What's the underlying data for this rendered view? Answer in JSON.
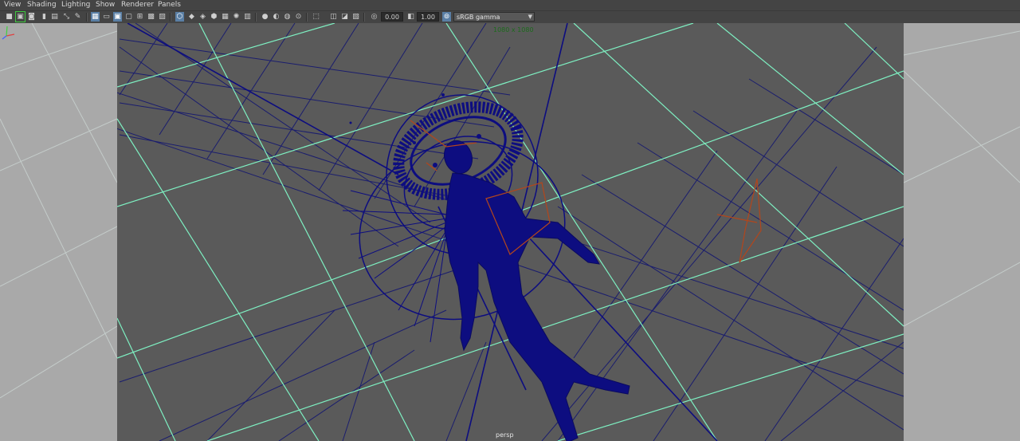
{
  "menu": [
    "View",
    "Shading",
    "Lighting",
    "Show",
    "Renderer",
    "Panels"
  ],
  "toolbar": {
    "exposure_value": "0.00",
    "gamma_value": "1.00",
    "color_space": "sRGB gamma",
    "icons": [
      "select-camera-icon",
      "camera-attributes-icon",
      "bookmark-icon",
      "image-plane-icon",
      "2d-pan-zoom-icon",
      "grease-pencil-icon",
      "grid-icon",
      "film-gate-icon",
      "resolution-gate-icon",
      "gate-mask-icon",
      "field-chart-icon",
      "safe-action-icon",
      "wireframe-icon",
      "smooth-shade-icon",
      "default-material-icon",
      "wireframe-on-shaded-icon",
      "textured-icon",
      "use-all-lights-icon",
      "shadows-icon",
      "screen-space-ao-icon",
      "motion-blur-icon",
      "multisample-aa-icon",
      "depth-of-field-icon",
      "isolate-select-icon",
      "xray-icon",
      "xray-joints-icon",
      "backface-culling-icon",
      "exposure-icon",
      "gamma-icon",
      "color-management-icon"
    ]
  },
  "viewport": {
    "resolution_label": "1080 x 1080",
    "camera_label": "persp",
    "grid_color": "#7ef0c2",
    "wire_color": "#0d0d80",
    "selected_color": "#b2461c",
    "background_color": "#5a5a5a",
    "outside_gate_color": "#a9a9a9"
  }
}
